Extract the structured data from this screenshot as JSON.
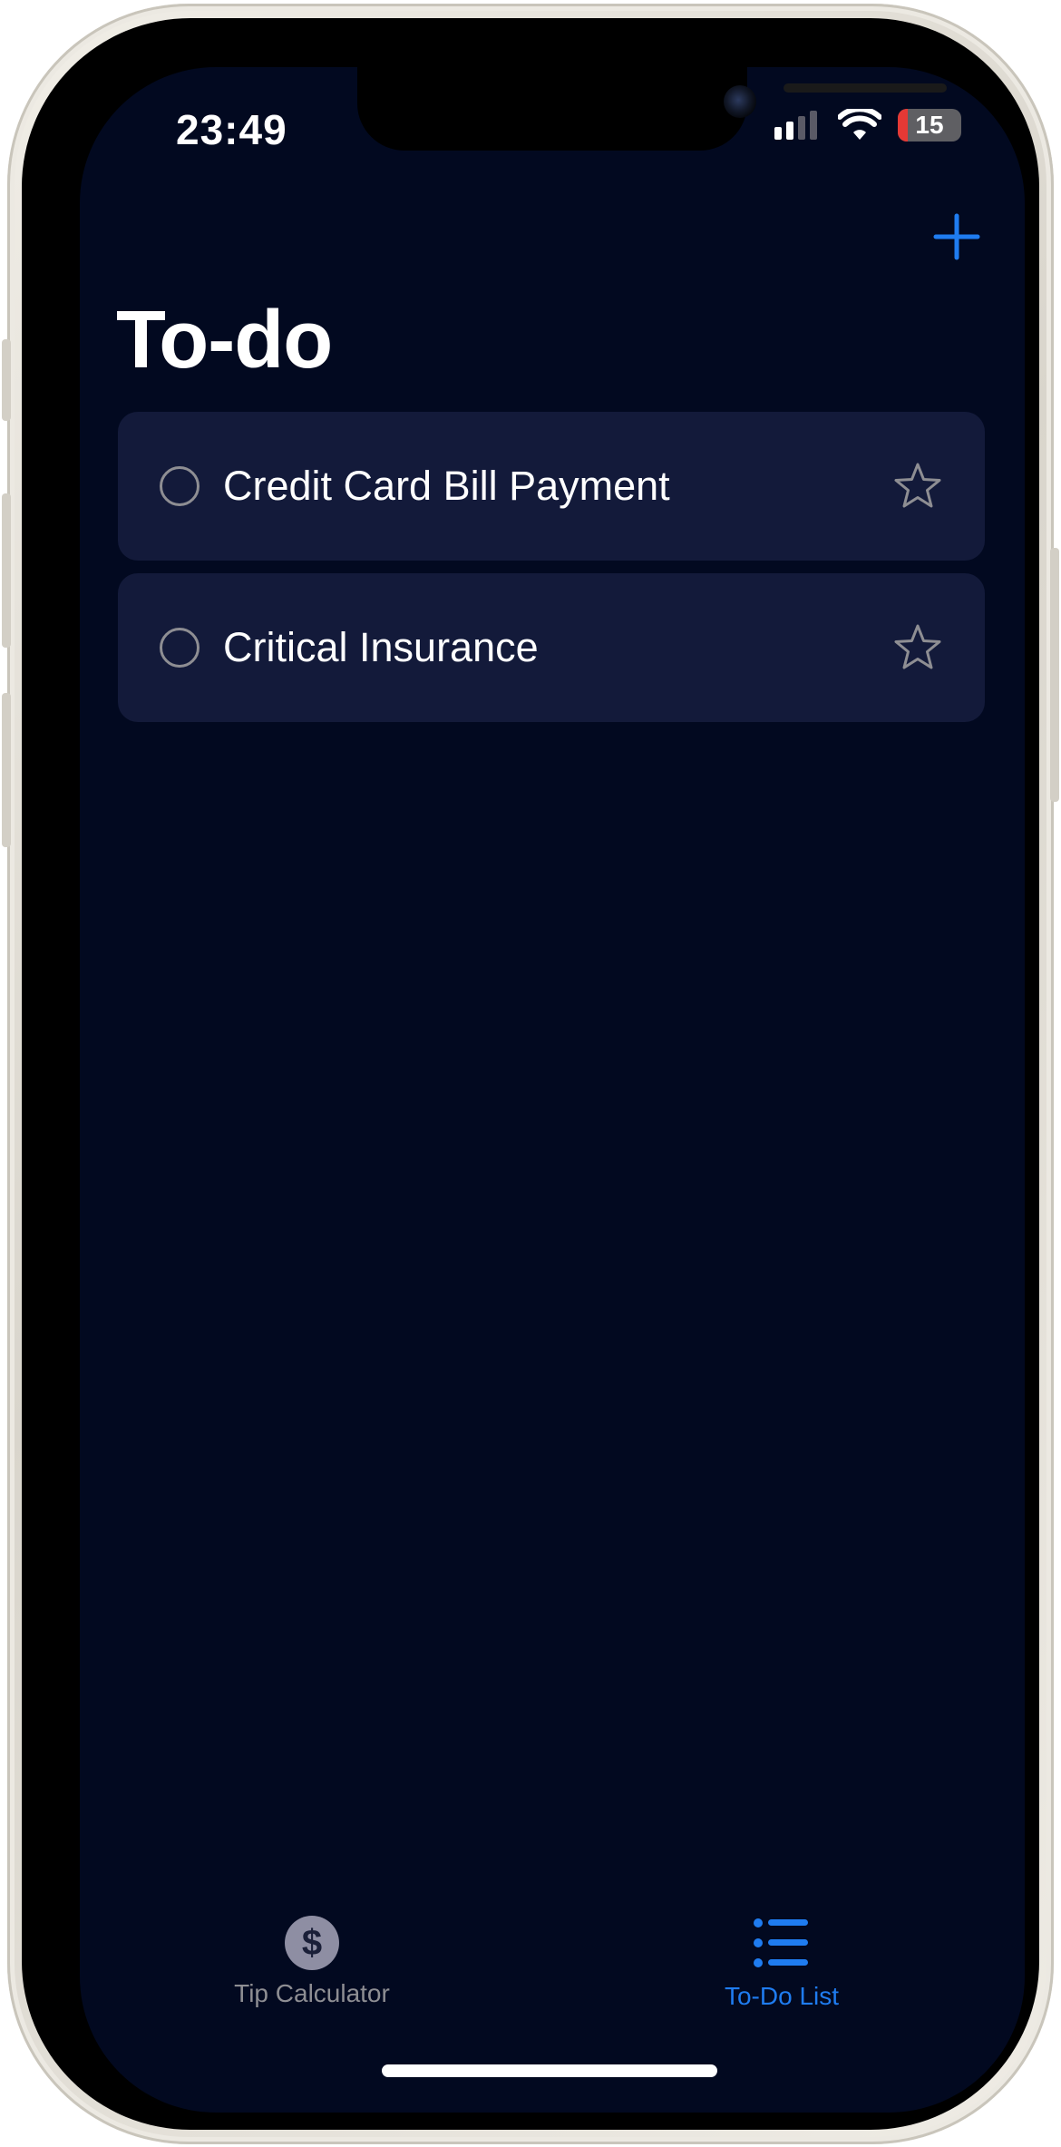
{
  "status_bar": {
    "time": "23:49",
    "battery_level": "15",
    "battery_color": "#e53935",
    "signal_icon": "cellular-signal-icon",
    "wifi_icon": "wifi-icon"
  },
  "header": {
    "add_icon": "plus-icon",
    "title": "To-do"
  },
  "todos": [
    {
      "title": "Credit Card Bill Payment",
      "completed": false,
      "starred": false
    },
    {
      "title": "Critical Insurance",
      "completed": false,
      "starred": false
    }
  ],
  "tab_bar": {
    "tabs": [
      {
        "label": "Tip Calculator",
        "icon": "dollar-sign-icon",
        "selected": false
      },
      {
        "label": "To-Do List",
        "icon": "list-bullet-icon",
        "selected": true
      }
    ]
  },
  "colors": {
    "background": "#020920",
    "card": "#131a3a",
    "accent": "#1f7cf0",
    "inactive": "#8e8e93"
  }
}
